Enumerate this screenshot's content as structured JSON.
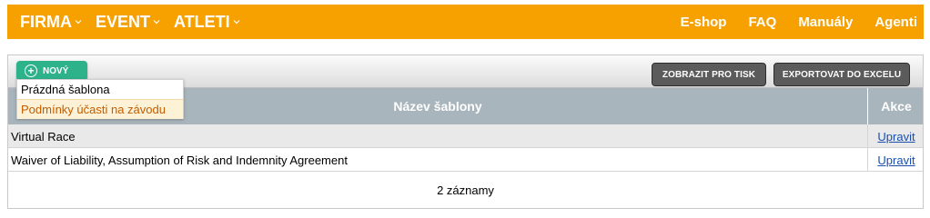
{
  "nav": {
    "left": [
      {
        "label": "FIRMA"
      },
      {
        "label": "EVENT"
      },
      {
        "label": "ATLETI"
      }
    ],
    "right": [
      {
        "label": "E-shop"
      },
      {
        "label": "FAQ"
      },
      {
        "label": "Manuály"
      },
      {
        "label": "Agenti"
      }
    ]
  },
  "toolbar": {
    "new_label": "NOVÝ",
    "print_label": "ZOBRAZIT PRO TISK",
    "export_label": "EXPORTOVAT DO EXCELU"
  },
  "dropdown": {
    "items": [
      {
        "label": "Prázdná šablona"
      },
      {
        "label": "Podmínky účasti na závodu"
      }
    ]
  },
  "table": {
    "headers": {
      "name": "Název šablony",
      "actions": "Akce"
    },
    "rows": [
      {
        "name": "Virtual Race",
        "action": "Upravit"
      },
      {
        "name": "Waiver of Liability, Assumption of Risk and Indemnity Agreement",
        "action": "Upravit"
      }
    ],
    "footer": "2 záznamy"
  },
  "colors": {
    "nav_bg": "#f7a100",
    "new_button": "#2db28a",
    "header_bg": "#a9b5bc",
    "link": "#1a4fb0",
    "dropdown_highlight": "#c45c00"
  },
  "icons": {
    "chevron": "chevron-down-icon",
    "plus": "plus-circle-icon"
  }
}
